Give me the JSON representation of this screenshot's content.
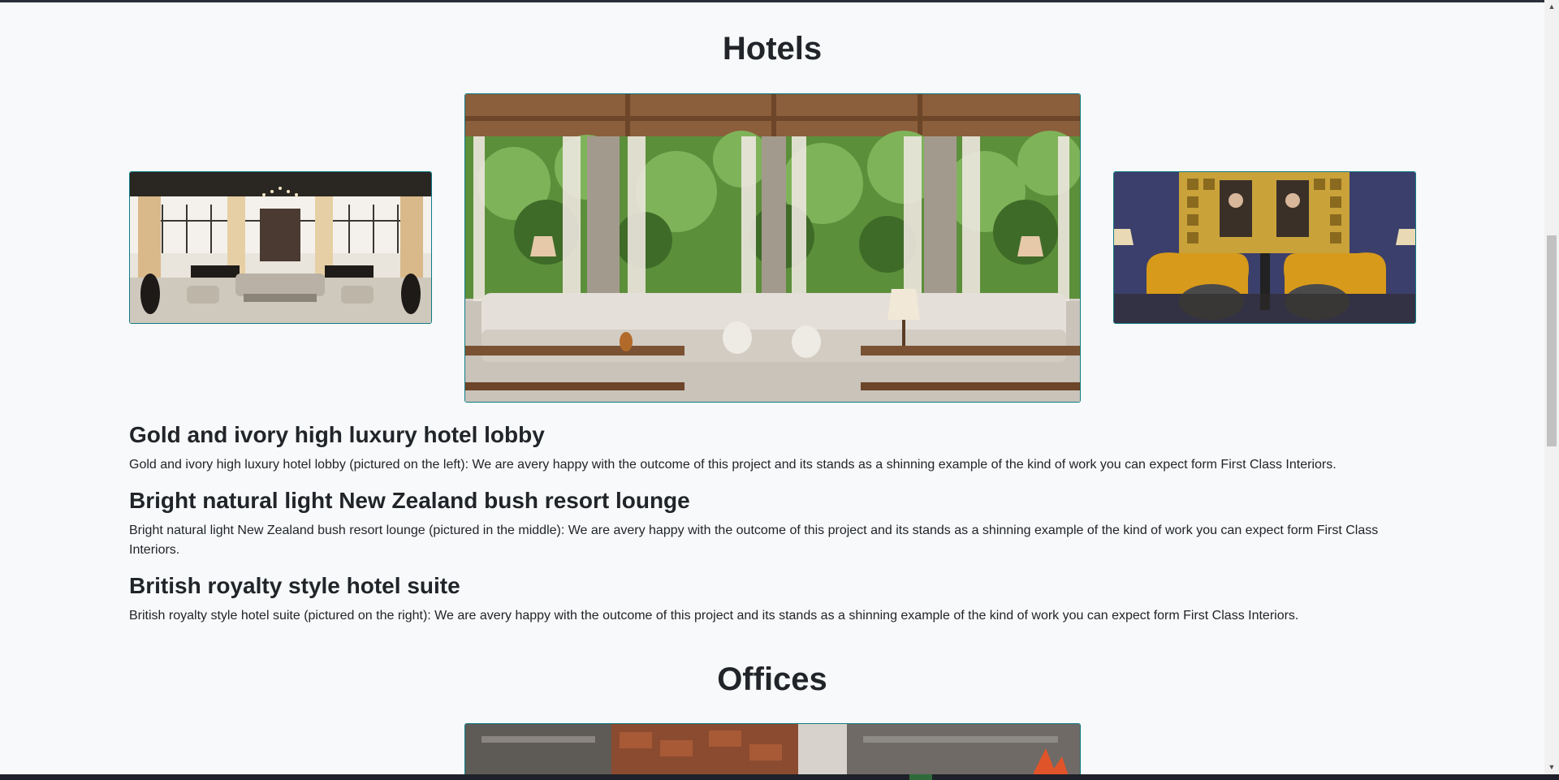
{
  "hotels": {
    "heading": "Hotels",
    "items": [
      {
        "title": "Gold and ivory high luxury hotel lobby",
        "description": "Gold and ivory high luxury hotel lobby (pictured on the left): We are avery happy with the outcome of this project and its stands as a shinning example of the kind of work you can expect form First Class Interiors."
      },
      {
        "title": "Bright natural light New Zealand bush resort lounge",
        "description": "Bright natural light New Zealand bush resort lounge (pictured in the middle): We are avery happy with the outcome of this project and its stands as a shinning example of the kind of work you can expect form First Class Interiors."
      },
      {
        "title": "British royalty style hotel suite",
        "description": "British royalty style hotel suite (pictured on the right): We are avery happy with the outcome of this project and its stands as a shinning example of the kind of work you can expect form First Class Interiors."
      }
    ]
  },
  "offices": {
    "heading": "Offices"
  },
  "colors": {
    "background": "#f8f9fa",
    "image_border": "#0e7c86",
    "text": "#212529"
  }
}
